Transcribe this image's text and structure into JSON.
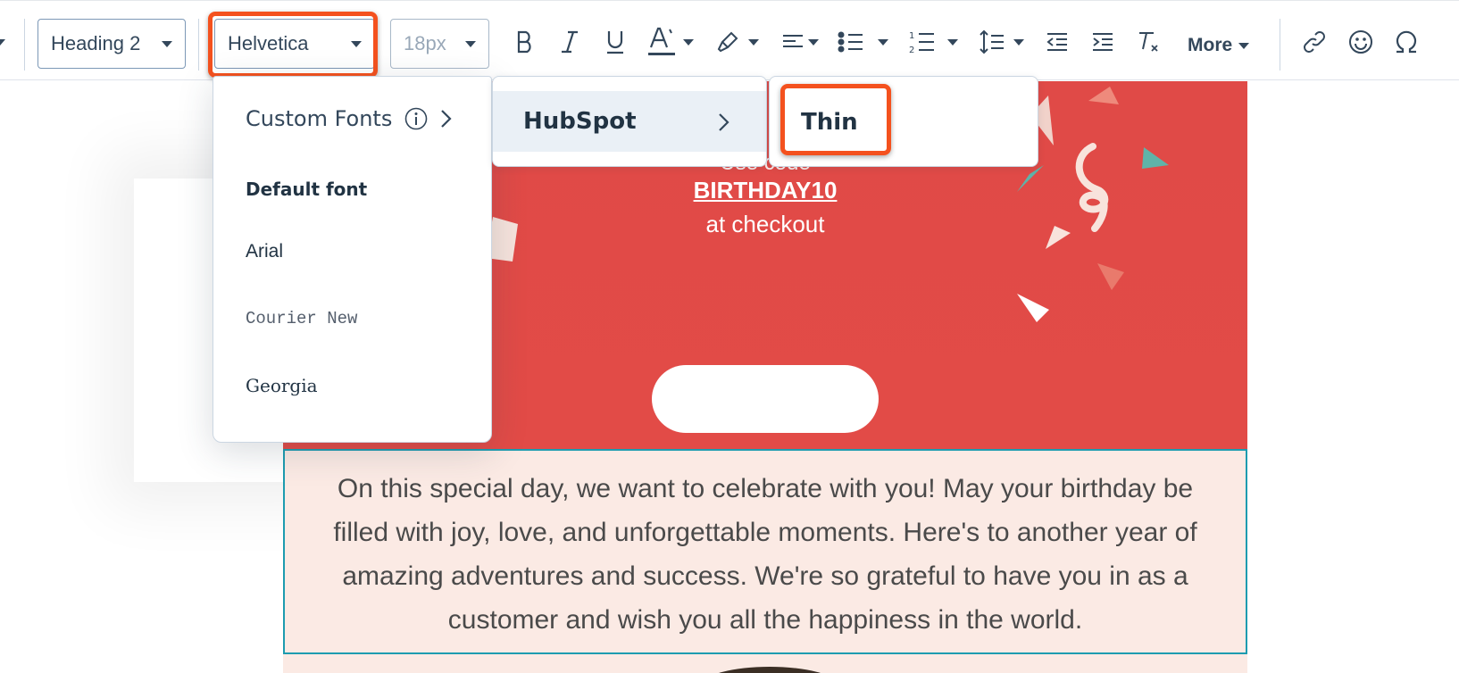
{
  "toolbar": {
    "style_select": {
      "value": "Heading 2"
    },
    "font_select": {
      "value": "Helvetica"
    },
    "size_select": {
      "value": "18px"
    },
    "more_label": "More",
    "icons": [
      "bold-icon",
      "italic-icon",
      "underline-icon",
      "text-color-icon",
      "highlight-icon",
      "align-left-icon",
      "bulleted-list-icon",
      "numbered-list-icon",
      "line-height-icon",
      "outdent-icon",
      "indent-icon",
      "clear-format-icon",
      "link-icon",
      "emoji-icon",
      "special-character-icon"
    ],
    "highlight_color": "#f4511e"
  },
  "font_menu": {
    "custom_fonts_label": "Custom Fonts",
    "default_font_heading": "Default font",
    "fonts": [
      "Arial",
      "Courier New",
      "Georgia"
    ]
  },
  "custom_fonts_submenu": {
    "hubspot_label": "HubSpot"
  },
  "hubspot_submenu": {
    "thin_label": "Thin"
  },
  "email": {
    "hero": {
      "partial_line": "Use code",
      "promo_code": "BIRTHDAY10",
      "checkout_text": "at checkout",
      "background": "#e24b47"
    },
    "body_text": "On this special day, we want to celebrate with you! May your birthday be filled with joy, love, and unforgettable moments. Here's to another year of amazing adventures and success. We're so grateful to have you in as a customer and wish you all the happiness in the world.",
    "body_background": "#fbeae4",
    "selection_border": "#1d9cb0"
  }
}
